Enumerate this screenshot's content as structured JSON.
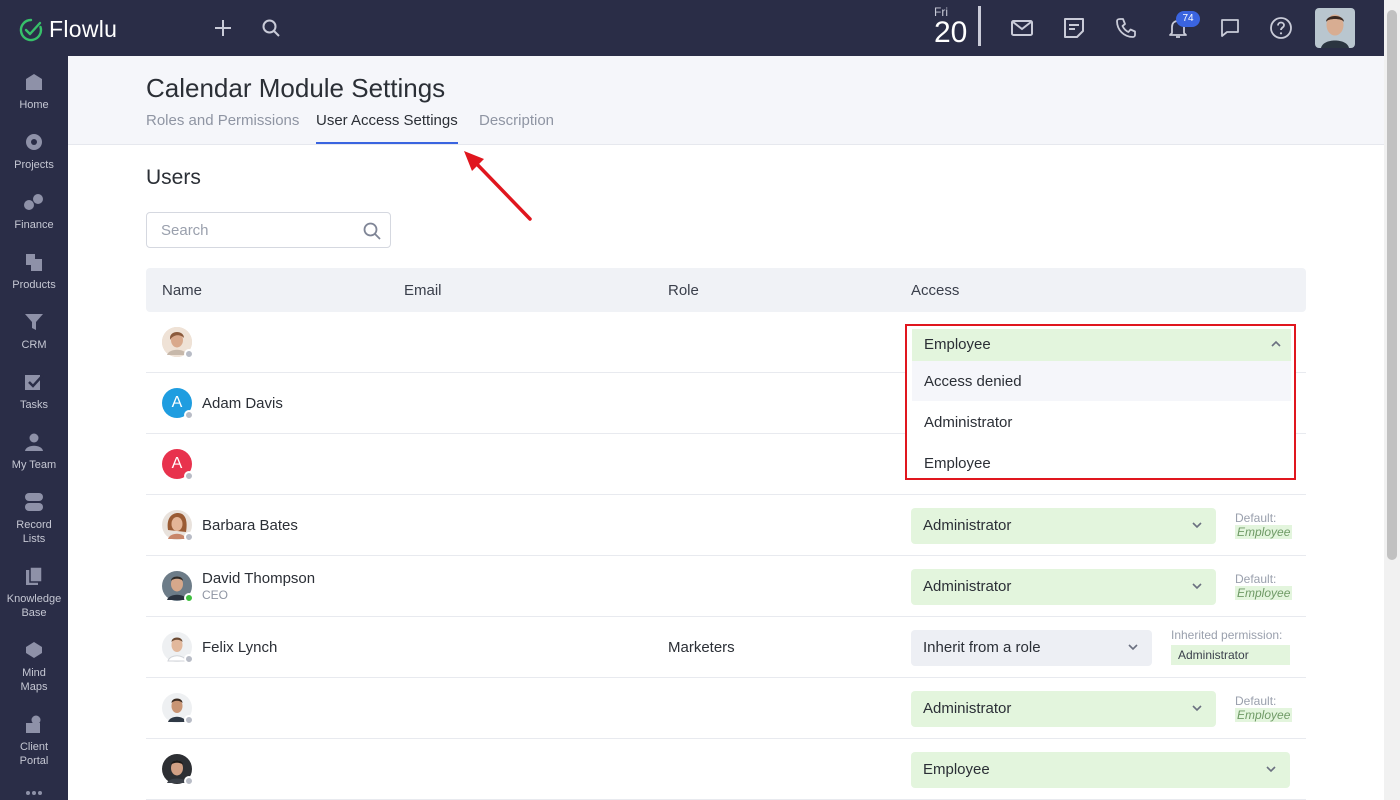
{
  "app": {
    "name": "Flowlu"
  },
  "topbar": {
    "date_day": "Fri",
    "date_num": "20",
    "notification_count": "74"
  },
  "sidebar": {
    "items": [
      {
        "label": "Home",
        "icon": "home-icon"
      },
      {
        "label": "Projects",
        "icon": "projects-icon"
      },
      {
        "label": "Finance",
        "icon": "finance-icon"
      },
      {
        "label": "Products",
        "icon": "products-icon"
      },
      {
        "label": "CRM",
        "icon": "crm-icon"
      },
      {
        "label": "Tasks",
        "icon": "tasks-icon"
      },
      {
        "label": "My Team",
        "icon": "team-icon"
      },
      {
        "label": "Record Lists",
        "icon": "record-lists-icon"
      },
      {
        "label": "Knowledge Base",
        "icon": "knowledge-base-icon"
      },
      {
        "label": "Mind Maps",
        "icon": "mind-maps-icon"
      },
      {
        "label": "Client Portal",
        "icon": "client-portal-icon"
      }
    ]
  },
  "page": {
    "title": "Calendar Module Settings",
    "tabs": [
      {
        "label": "Roles and Permissions",
        "active": false
      },
      {
        "label": "User Access Settings",
        "active": true
      },
      {
        "label": "Description",
        "active": false
      }
    ]
  },
  "users": {
    "title": "Users",
    "search_placeholder": "Search",
    "columns": [
      "Name",
      "Email",
      "Role",
      "Access"
    ],
    "rows": [
      {
        "name": "",
        "subtitle": "",
        "role": "",
        "access": "Employee",
        "online": false
      },
      {
        "name": "Adam Davis",
        "subtitle": "",
        "role": "",
        "access": "",
        "online": false,
        "initial": "A",
        "avatar_color": "#1f9de0"
      },
      {
        "name": "",
        "subtitle": "",
        "role": "",
        "access": "",
        "online": false,
        "initial": "A",
        "avatar_color": "#e8324d"
      },
      {
        "name": "Barbara Bates",
        "subtitle": "",
        "role": "",
        "access": "Administrator",
        "online": false,
        "note_label": "Default:",
        "note_value": "Employee"
      },
      {
        "name": "David Thompson",
        "subtitle": "CEO",
        "role": "",
        "access": "Administrator",
        "online": true,
        "note_label": "Default:",
        "note_value": "Employee"
      },
      {
        "name": "Felix Lynch",
        "subtitle": "",
        "role": "Marketers",
        "access": "Inherit from a role",
        "online": false,
        "note_label": "Inherited permission:",
        "note_value": "Administrator"
      },
      {
        "name": "",
        "subtitle": "",
        "role": "",
        "access": "Administrator",
        "online": false,
        "note_label": "Default:",
        "note_value": "Employee"
      },
      {
        "name": "",
        "subtitle": "",
        "role": "",
        "access": "Employee",
        "online": false
      }
    ]
  },
  "dropdown": {
    "selected": "Employee",
    "options": [
      "Access denied",
      "Administrator",
      "Employee"
    ],
    "highlighted": "Access denied"
  },
  "colors": {
    "topbar_bg": "#2a2d47",
    "accent": "#3a64e0",
    "access_bg": "#e3f5dd",
    "annotation": "#e0161e"
  }
}
